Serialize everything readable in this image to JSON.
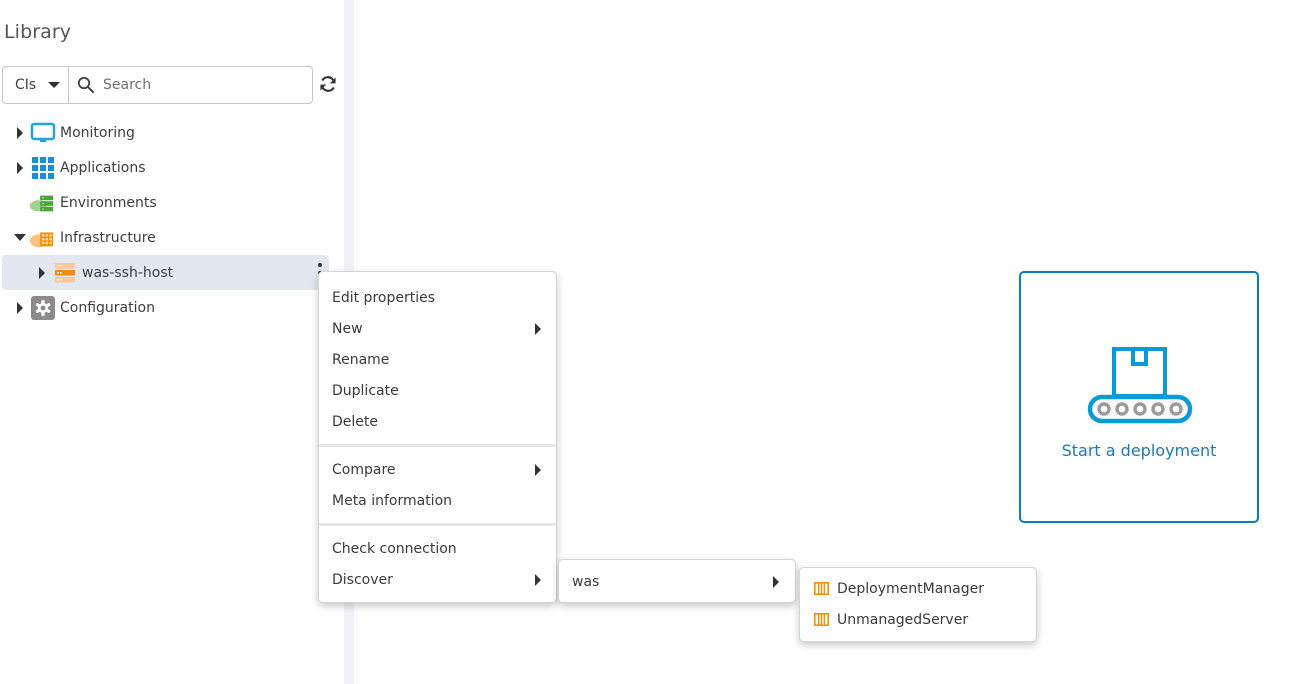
{
  "sidebar": {
    "title": "Library",
    "type_filter": {
      "selected": "CIs",
      "icon": "caret-down-icon"
    },
    "search": {
      "placeholder": "Search",
      "value": "",
      "icon": "search-icon"
    },
    "refresh_icon": "refresh-icon",
    "tree": [
      {
        "label": "Monitoring",
        "icon": "monitor-icon",
        "expanded": false,
        "has_children": true
      },
      {
        "label": "Applications",
        "icon": "applications-grid-icon",
        "expanded": false,
        "has_children": true
      },
      {
        "label": "Environments",
        "icon": "environments-cloud-icon",
        "expanded": false,
        "has_children": false
      },
      {
        "label": "Infrastructure",
        "icon": "infrastructure-cloud-icon",
        "expanded": true,
        "has_children": true,
        "children": [
          {
            "label": "was-ssh-host",
            "icon": "server-host-icon",
            "selected": true,
            "has_children": true,
            "menu_icon": "kebab-menu-icon"
          }
        ]
      },
      {
        "label": "Configuration",
        "icon": "gear-icon",
        "expanded": false,
        "has_children": true
      }
    ]
  },
  "context_menu": {
    "groups": [
      [
        {
          "label": "Edit properties",
          "submenu": false
        },
        {
          "label": "New",
          "submenu": true
        },
        {
          "label": "Rename",
          "submenu": false
        },
        {
          "label": "Duplicate",
          "submenu": false
        },
        {
          "label": "Delete",
          "submenu": false
        }
      ],
      [
        {
          "label": "Compare",
          "submenu": true
        },
        {
          "label": "Meta information",
          "submenu": false
        }
      ],
      [
        {
          "label": "Check connection",
          "submenu": false
        },
        {
          "label": "Discover",
          "submenu": true
        }
      ]
    ]
  },
  "discover_submenu": {
    "items": [
      {
        "label": "was",
        "submenu": true
      }
    ]
  },
  "was_submenu": {
    "items": [
      {
        "label": "DeploymentManager",
        "icon": "ci-type-icon"
      },
      {
        "label": "UnmanagedServer",
        "icon": "ci-type-icon"
      }
    ]
  },
  "main": {
    "deploy_card": {
      "label": "Start a deployment",
      "icon": "conveyor-belt-package-icon"
    }
  },
  "colors": {
    "accent_blue": "#0a7cc1",
    "link_blue": "#1d78b8",
    "orange": "#f39200",
    "green": "#5cae4a",
    "selected_row": "#e3e7ef"
  }
}
